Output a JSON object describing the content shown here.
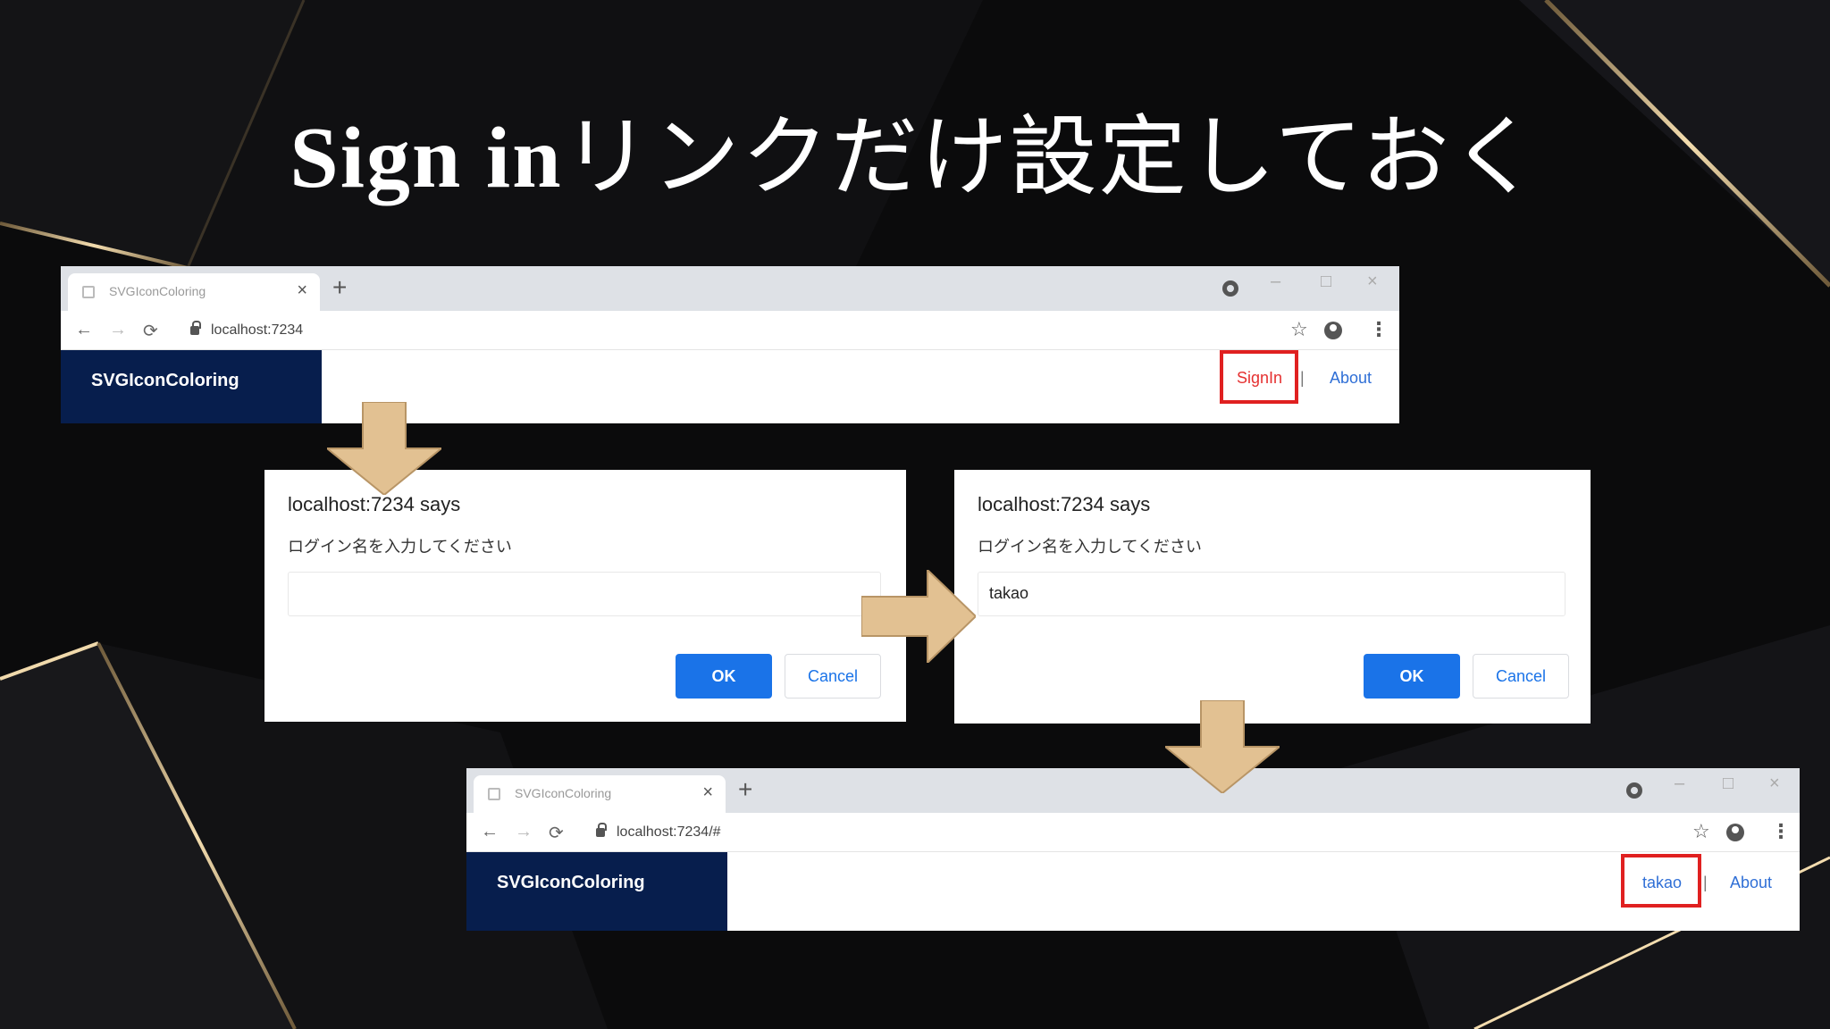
{
  "slide": {
    "title_latin": "Sign in",
    "title_jp": "リンクだけ設定しておく"
  },
  "browser_top": {
    "tab_title": "SVGIconColoring",
    "url": "localhost:7234",
    "brand": "SVGIconColoring",
    "nav": {
      "signin": "SignIn",
      "separator": "|",
      "about": "About"
    }
  },
  "dialog_empty": {
    "title": "localhost:7234 says",
    "message": "ログイン名を入力してください",
    "input_value": "",
    "ok": "OK",
    "cancel": "Cancel"
  },
  "dialog_filled": {
    "title": "localhost:7234 says",
    "message": "ログイン名を入力してください",
    "input_value": "takao",
    "ok": "OK",
    "cancel": "Cancel"
  },
  "browser_bottom": {
    "tab_title": "SVGIconColoring",
    "url": "localhost:7234/#",
    "brand": "SVGIconColoring",
    "nav": {
      "user": "takao",
      "separator": "|",
      "about": "About"
    }
  },
  "icons": [
    "favicon-icon",
    "close-icon",
    "plus-icon",
    "record-icon",
    "back-icon",
    "forward-icon",
    "reload-icon",
    "lock-icon",
    "star-icon",
    "account-icon",
    "kebab-icon",
    "arrow-down-icon",
    "arrow-right-icon"
  ],
  "colors": {
    "brand_bar": "#071e4d",
    "link": "#2f6fd6",
    "highlight": "#e02020",
    "ok_button": "#1a73e8",
    "arrow_fill": "#e2c192"
  }
}
